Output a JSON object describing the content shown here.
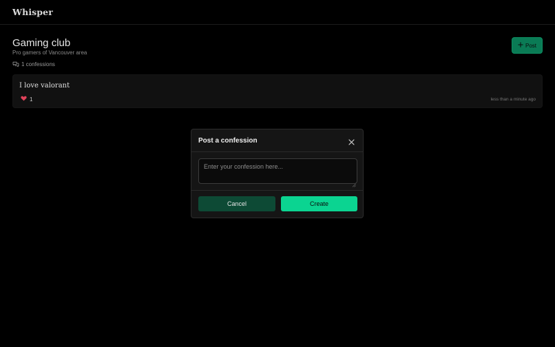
{
  "app": {
    "brand": "Whisper"
  },
  "club": {
    "title": "Gaming club",
    "subtitle": "Pro gamers of Vancouver area",
    "count_label": "1 confessions"
  },
  "header_actions": {
    "post_label": "Post"
  },
  "confessions": [
    {
      "text": "I love valorant",
      "likes": "1",
      "time": "less than a minute ago"
    }
  ],
  "modal": {
    "title": "Post a confession",
    "placeholder": "Enter your confession here...",
    "cancel_label": "Cancel",
    "create_label": "Create"
  },
  "icons": {
    "comments": "comments-icon",
    "plus": "plus-icon",
    "heart": "heart-icon",
    "close": "close-icon"
  },
  "colors": {
    "accent": "#0bd491",
    "accent_dark": "#0a7b55",
    "cancel_bg": "#0d4a35",
    "heart": "#e0425a",
    "background": "#000000"
  }
}
